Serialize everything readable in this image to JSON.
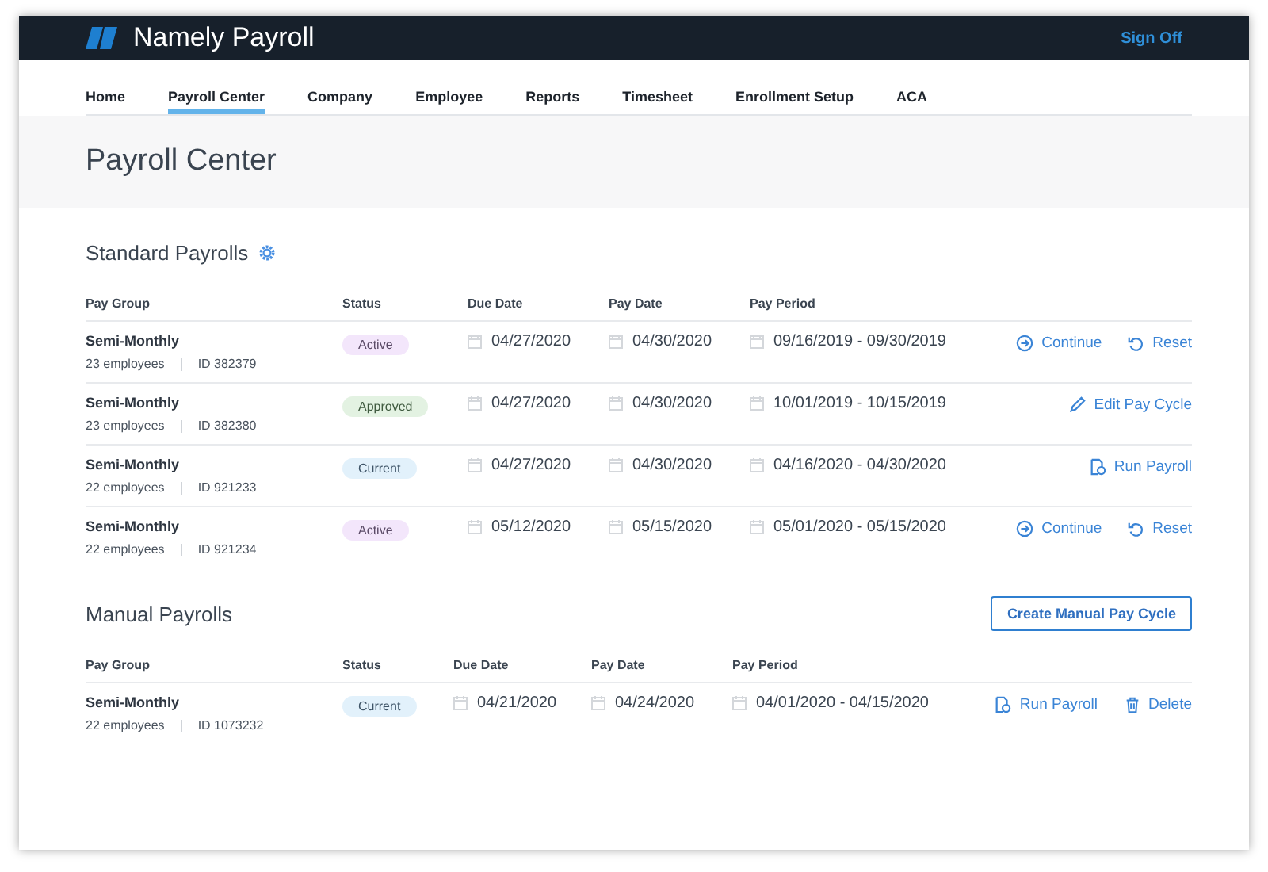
{
  "app": {
    "title": "Namely Payroll",
    "sign_off": "Sign Off"
  },
  "nav": [
    {
      "label": "Home",
      "selected": false
    },
    {
      "label": "Payroll Center",
      "selected": true
    },
    {
      "label": "Company",
      "selected": false
    },
    {
      "label": "Employee",
      "selected": false
    },
    {
      "label": "Reports",
      "selected": false
    },
    {
      "label": "Timesheet",
      "selected": false
    },
    {
      "label": "Enrollment Setup",
      "selected": false
    },
    {
      "label": "ACA",
      "selected": false
    }
  ],
  "page_title": "Payroll Center",
  "sections": [
    {
      "title": "Standard Payrolls",
      "settings": true,
      "columns": [
        "Pay Group",
        "Status",
        "Due Date",
        "Pay Date",
        "Pay Period"
      ],
      "rows": [
        {
          "group": "Semi-Monthly",
          "employees": "23 employees",
          "id": "ID 382379",
          "status": {
            "label": "Active",
            "kind": "active"
          },
          "due": "04/27/2020",
          "pay": "04/30/2020",
          "period": "09/16/2019 - 09/30/2019",
          "actions": [
            {
              "kind": "continue",
              "label": "Continue"
            },
            {
              "kind": "reset",
              "label": "Reset"
            }
          ]
        },
        {
          "group": "Semi-Monthly",
          "employees": "23 employees",
          "id": "ID 382380",
          "status": {
            "label": "Approved",
            "kind": "approved"
          },
          "due": "04/27/2020",
          "pay": "04/30/2020",
          "period": "10/01/2019 - 10/15/2019",
          "actions": [
            {
              "kind": "edit",
              "label": "Edit Pay Cycle"
            }
          ]
        },
        {
          "group": "Semi-Monthly",
          "employees": "22 employees",
          "id": "ID 921233",
          "status": {
            "label": "Current",
            "kind": "current"
          },
          "due": "04/27/2020",
          "pay": "04/30/2020",
          "period": "04/16/2020 - 04/30/2020",
          "actions": [
            {
              "kind": "run",
              "label": "Run Payroll"
            }
          ]
        },
        {
          "group": "Semi-Monthly",
          "employees": "22 employees",
          "id": "ID 921234",
          "status": {
            "label": "Active",
            "kind": "active"
          },
          "due": "05/12/2020",
          "pay": "05/15/2020",
          "period": "05/01/2020 - 05/15/2020",
          "actions": [
            {
              "kind": "continue",
              "label": "Continue"
            },
            {
              "kind": "reset",
              "label": "Reset"
            }
          ]
        }
      ]
    },
    {
      "title": "Manual Payrolls",
      "button": "Create Manual Pay Cycle",
      "columns": [
        "Pay Group",
        "Status",
        "Due Date",
        "Pay Date",
        "Pay Period"
      ],
      "rows": [
        {
          "group": "Semi-Monthly",
          "employees": "22 employees",
          "id": "ID 1073232",
          "status": {
            "label": "Current",
            "kind": "current"
          },
          "due": "04/21/2020",
          "pay": "04/24/2020",
          "period": "04/01/2020 - 04/15/2020",
          "actions": [
            {
              "kind": "run",
              "label": "Run Payroll"
            },
            {
              "kind": "delete",
              "label": "Delete"
            }
          ]
        }
      ]
    }
  ]
}
